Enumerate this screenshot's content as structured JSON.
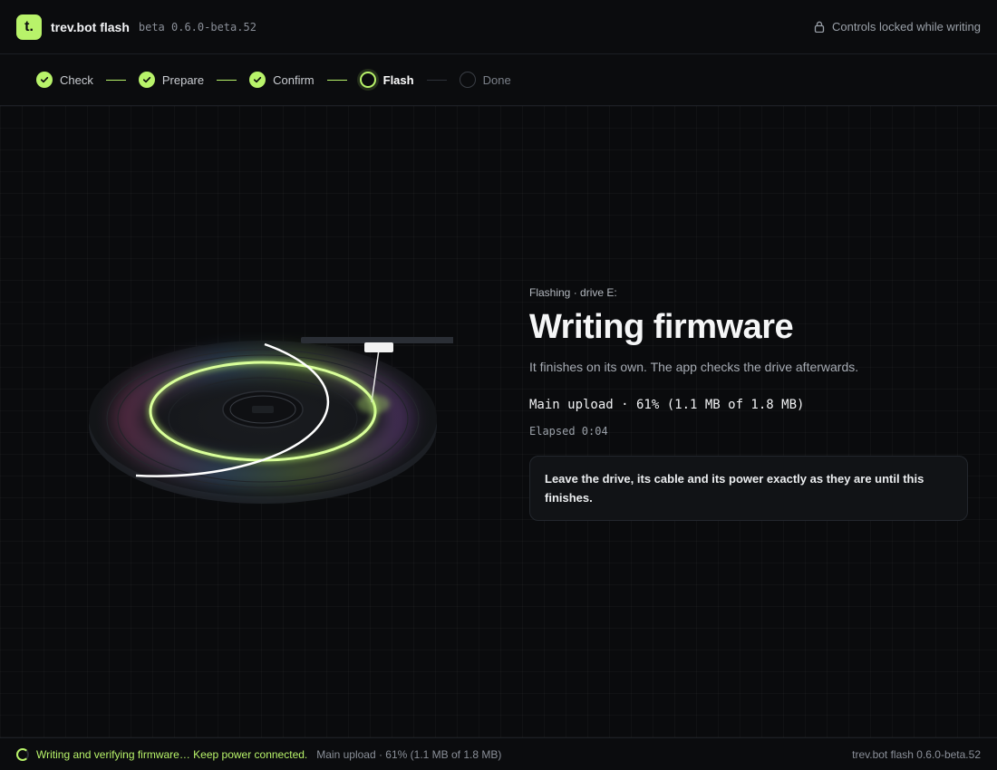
{
  "app": {
    "logo_letter": "t.",
    "name": "trev.bot flash",
    "version": "beta 0.6.0-beta.52",
    "lock_text": "Controls locked while writing"
  },
  "steps": [
    {
      "label": "Check",
      "state": "done"
    },
    {
      "label": "Prepare",
      "state": "done"
    },
    {
      "label": "Confirm",
      "state": "done"
    },
    {
      "label": "Flash",
      "state": "active"
    },
    {
      "label": "Done",
      "state": "pending"
    }
  ],
  "main": {
    "kicker": "Flashing · drive E:",
    "title": "Writing firmware",
    "subtitle": "It finishes on its own. The app checks the drive afterwards.",
    "progress_text": "Main upload · 61% (1.1 MB of 1.8 MB)",
    "progress_fraction": 0.61,
    "elapsed": "Elapsed 0:04",
    "notice": "Leave the drive, its cable and its power exactly as they are until this finishes."
  },
  "footer": {
    "status": "Writing and verifying firmware… Keep power connected.",
    "progress": "Main upload · 61% (1.1 MB of 1.8 MB)",
    "version": "trev.bot flash 0.6.0-beta.52"
  },
  "colors": {
    "accent": "#b8f36a",
    "background": "#0a0b0d"
  },
  "icons": {
    "lock": "lock-icon",
    "check": "check-icon",
    "spinner": "spinner-icon"
  }
}
